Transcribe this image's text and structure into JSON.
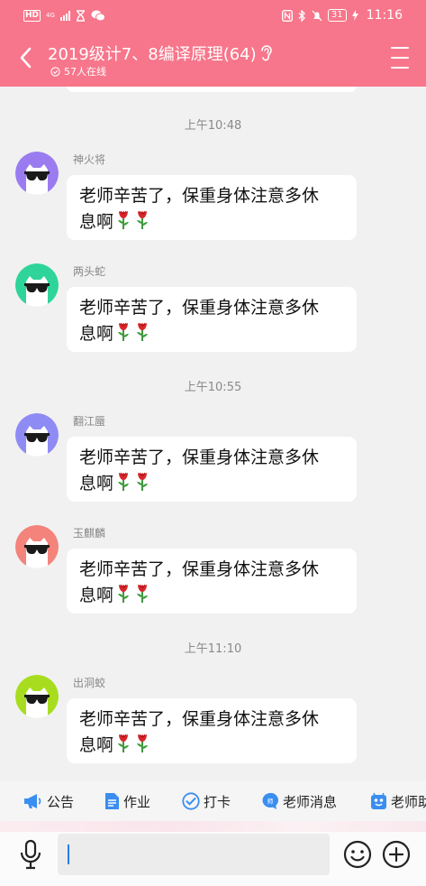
{
  "status_bar": {
    "hd": "HD",
    "network": "4G",
    "battery": "31",
    "time": "11:16"
  },
  "header": {
    "title": "2019级计7、8编译原理(64)",
    "online": "57人在线",
    "back_icon": "chevron-left-icon",
    "ear_icon": "ear-icon",
    "menu_icon": "hamburger-menu-icon"
  },
  "colors": {
    "header_bg": "#f7768b",
    "chat_bg": "#f1f1f1",
    "bubble_bg": "#ffffff",
    "time_text": "#8a8a8a"
  },
  "chat": {
    "time_separators": [
      "上午10:48",
      "上午10:55",
      "上午11:10"
    ],
    "messages": [
      {
        "sender": "神火将",
        "text": "老师辛苦了，保重身体注意多休",
        "text2": "息啊",
        "avatar_color": "#9a7cf0"
      },
      {
        "sender": "两头蛇",
        "text": "老师辛苦了，保重身体注意多休",
        "text2": "息啊",
        "avatar_color": "#2ed49a"
      },
      {
        "sender": "翻江蜃",
        "text": "老师辛苦了，保重身体注意多休",
        "text2": "息啊",
        "avatar_color": "#8f8bf5"
      },
      {
        "sender": "玉麒麟",
        "text": "老师辛苦了，保重身体注意多休",
        "text2": "息啊",
        "avatar_color": "#f4837b"
      },
      {
        "sender": "出洞蛟",
        "text": "老师辛苦了，保重身体注意多休",
        "text2": "息啊",
        "avatar_color": "#a8dd1f"
      }
    ]
  },
  "quick_bar": {
    "items": [
      {
        "label": "公告",
        "icon": "megaphone-icon"
      },
      {
        "label": "作业",
        "icon": "document-icon"
      },
      {
        "label": "打卡",
        "icon": "checkin-icon"
      },
      {
        "label": "老师消息",
        "icon": "teacher-message-icon"
      },
      {
        "label": "老师助",
        "icon": "teacher-assistant-icon"
      }
    ]
  },
  "input_bar": {
    "input_value": "",
    "mic_icon": "microphone-icon",
    "emoji_icon": "emoji-icon",
    "plus_icon": "plus-circle-icon"
  }
}
